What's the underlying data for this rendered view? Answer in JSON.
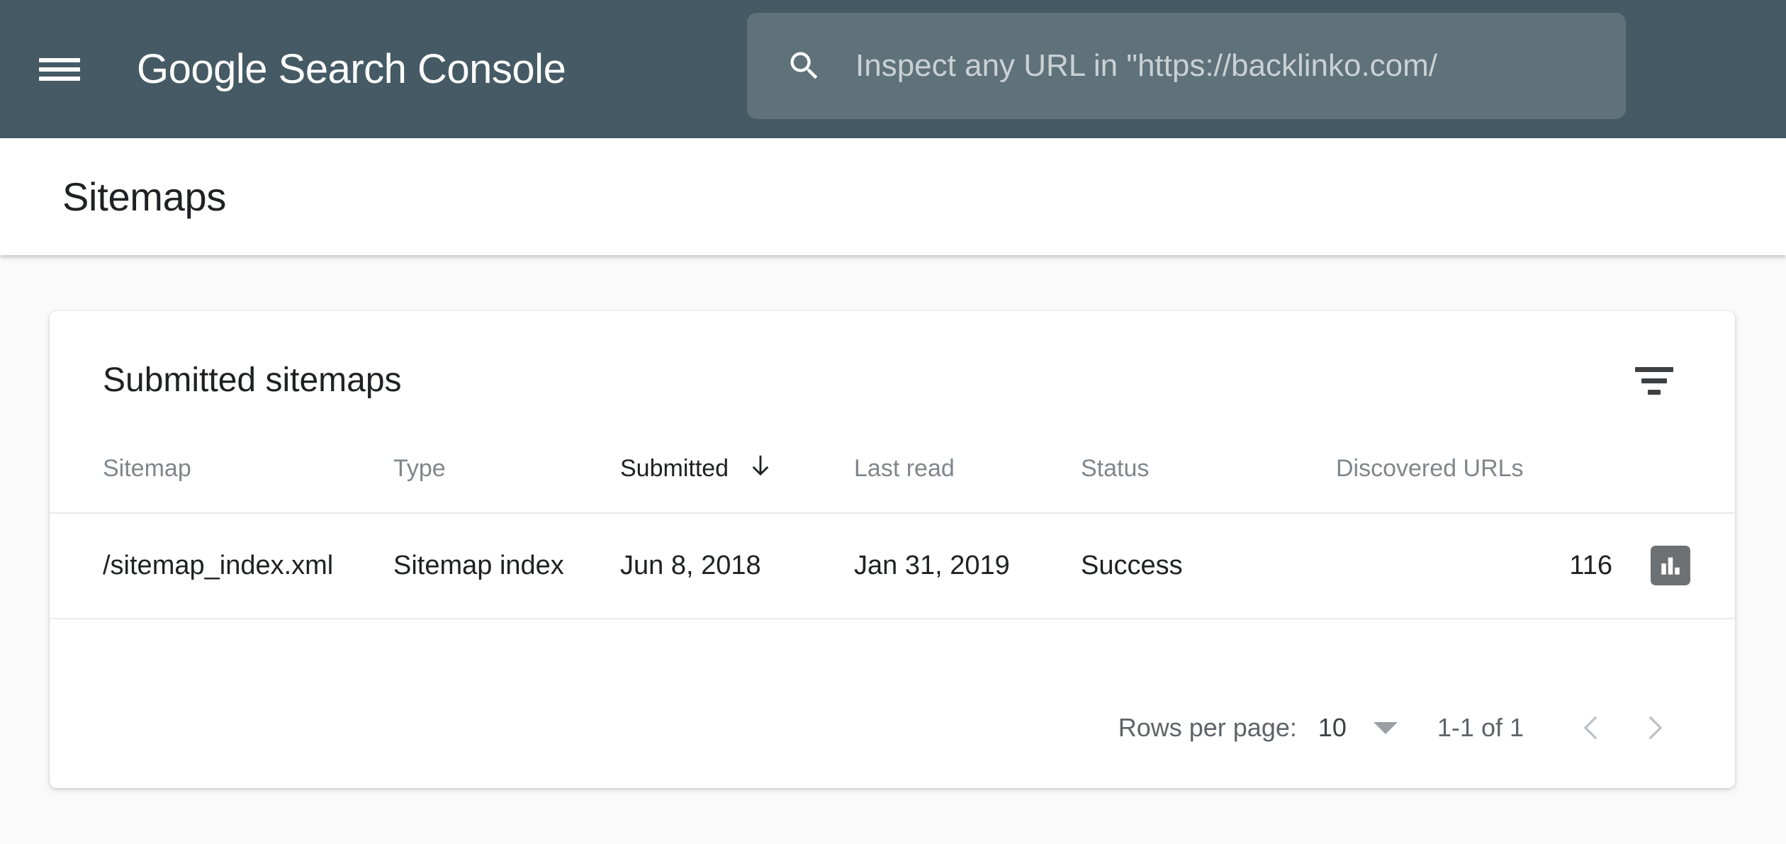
{
  "app_bar": {
    "menu_icon": "hamburger-menu-icon",
    "logo": {
      "brand": "Google",
      "product": " Search Console"
    },
    "search": {
      "icon": "search-icon",
      "value": "",
      "placeholder": "Inspect any URL in \"https://backlinko.com/"
    },
    "background_color": "#455A64"
  },
  "title_bar": {
    "title": "Sitemaps"
  },
  "card": {
    "title": "Submitted sitemaps",
    "filter_icon": "filter-icon",
    "table": {
      "columns": [
        {
          "label": "Sitemap",
          "sorted": false
        },
        {
          "label": "Type",
          "sorted": false
        },
        {
          "label": "Submitted",
          "sorted": true,
          "sort_direction": "descending"
        },
        {
          "label": "Last read",
          "sorted": false
        },
        {
          "label": "Status",
          "sorted": false
        },
        {
          "label": "Discovered URLs",
          "sorted": false
        }
      ],
      "rows": [
        {
          "sitemap": "/sitemap_index.xml",
          "type": "Sitemap index",
          "submitted": "Jun 8, 2018",
          "last_read": "Jan 31, 2019",
          "status": "Success",
          "status_color": "#188038",
          "discovered_urls": "116",
          "action_icon": "bar-chart-icon"
        }
      ]
    },
    "pagination": {
      "rows_per_page_label": "Rows per page:",
      "rows_per_page_value": "10",
      "range": "1-1 of 1",
      "prev_icon": "chevron-left-icon",
      "next_icon": "chevron-right-icon"
    }
  }
}
